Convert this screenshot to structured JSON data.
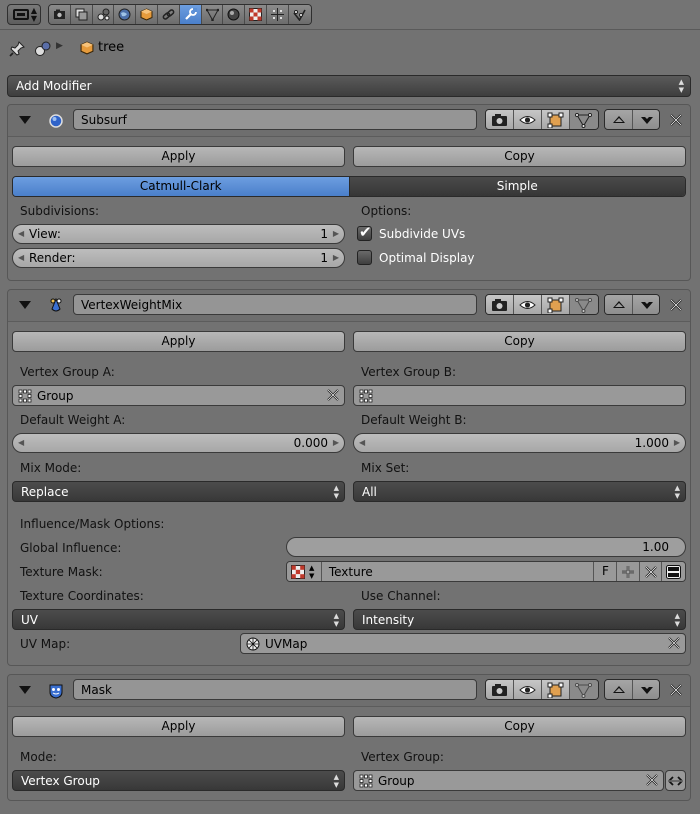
{
  "header": {
    "editor_type_icon": "properties-editor-icon",
    "context_tabs": [
      {
        "name": "render-icon",
        "active": false
      },
      {
        "name": "render-layers-icon",
        "active": false
      },
      {
        "name": "scene-icon",
        "active": false
      },
      {
        "name": "world-icon",
        "active": false
      },
      {
        "name": "object-icon",
        "active": false
      },
      {
        "name": "constraints-icon",
        "active": false
      },
      {
        "name": "modifiers-wrench-icon",
        "active": true
      },
      {
        "name": "object-data-icon",
        "active": false
      },
      {
        "name": "material-icon",
        "active": false
      },
      {
        "name": "texture-icon",
        "active": false
      },
      {
        "name": "particles-icon",
        "active": false
      },
      {
        "name": "physics-icon",
        "active": false
      }
    ]
  },
  "breadcrumb": {
    "object_name": "tree"
  },
  "add_modifier": {
    "label": "Add Modifier"
  },
  "colors": {
    "accent_blue": "#5a8fd6",
    "panel_bg": "#727272",
    "dark_field": "#3e3e3e"
  },
  "subsurf": {
    "name": "Subsurf",
    "apply_label": "Apply",
    "copy_label": "Copy",
    "algorithm_options": [
      "Catmull-Clark",
      "Simple"
    ],
    "algorithm_selected": "Catmull-Clark",
    "subdivisions_label": "Subdivisions:",
    "view_label": "View:",
    "view_value": "1",
    "render_label": "Render:",
    "render_value": "1",
    "options_label": "Options:",
    "subdivide_uvs_label": "Subdivide UVs",
    "subdivide_uvs_checked": true,
    "optimal_display_label": "Optimal Display",
    "optimal_display_checked": false
  },
  "vertex_weight_mix": {
    "name": "VertexWeightMix",
    "apply_label": "Apply",
    "copy_label": "Copy",
    "vgroup_a_label": "Vertex Group A:",
    "vgroup_a_value": "Group",
    "vgroup_b_label": "Vertex Group B:",
    "vgroup_b_value": "",
    "default_weight_a_label": "Default Weight A:",
    "default_weight_a_value": "0.000",
    "default_weight_b_label": "Default Weight B:",
    "default_weight_b_value": "1.000",
    "mix_mode_label": "Mix Mode:",
    "mix_mode_value": "Replace",
    "mix_set_label": "Mix Set:",
    "mix_set_value": "All",
    "influence_header": "Influence/Mask Options:",
    "global_influence_label": "Global Influence:",
    "global_influence_value": "1.00",
    "texture_mask_label": "Texture Mask:",
    "texture_value": "Texture",
    "fake_user_label": "F",
    "texture_coords_label": "Texture Coordinates:",
    "texture_coords_value": "UV",
    "use_channel_label": "Use Channel:",
    "use_channel_value": "Intensity",
    "uv_map_label": "UV Map:",
    "uv_map_value": "UVMap"
  },
  "mask": {
    "name": "Mask",
    "apply_label": "Apply",
    "copy_label": "Copy",
    "mode_label": "Mode:",
    "mode_value": "Vertex Group",
    "vertex_group_label": "Vertex Group:",
    "vertex_group_value": "Group"
  }
}
